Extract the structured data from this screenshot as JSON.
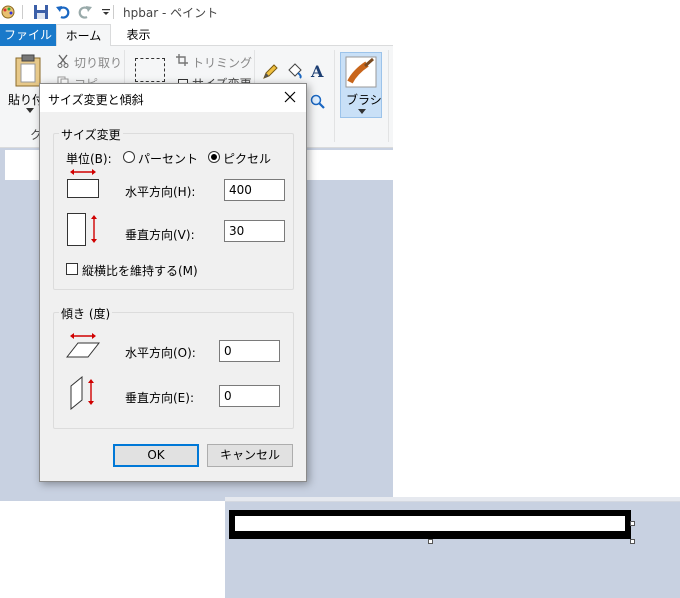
{
  "window": {
    "title": "hpbar - ペイント"
  },
  "ribbon": {
    "tabs": [
      "ファイル",
      "ホーム",
      "表示"
    ],
    "paste_label": "貼り付",
    "cut_label": "切り取り",
    "copy_label": "コピ",
    "crop_label": "トリミング",
    "resize_label": "サイズ変更",
    "clipboard_group": "ク",
    "brush_label": "ブラシ"
  },
  "dialog": {
    "title": "サイズ変更と傾斜",
    "resize_group": {
      "title": "サイズ変更",
      "unit_label": "単位(B):",
      "unit_options": [
        "パーセント",
        "ピクセル"
      ],
      "unit_selected": "ピクセル",
      "horizontal_label": "水平方向(H):",
      "horizontal_value": "400",
      "vertical_label": "垂直方向(V):",
      "vertical_value": "30",
      "keep_ratio_label": "縦横比を維持する(M)",
      "keep_ratio_checked": false
    },
    "skew_group": {
      "title": "傾き (度)",
      "horizontal_label": "水平方向(O):",
      "horizontal_value": "0",
      "vertical_label": "垂直方向(E):",
      "vertical_value": "0"
    },
    "ok_label": "OK",
    "cancel_label": "キャンセル"
  },
  "colors": {
    "file_tab": "#1979ca",
    "workspace": "#c8d1e1",
    "arrow_red": "#d00000",
    "ok_border": "#0078d7"
  }
}
